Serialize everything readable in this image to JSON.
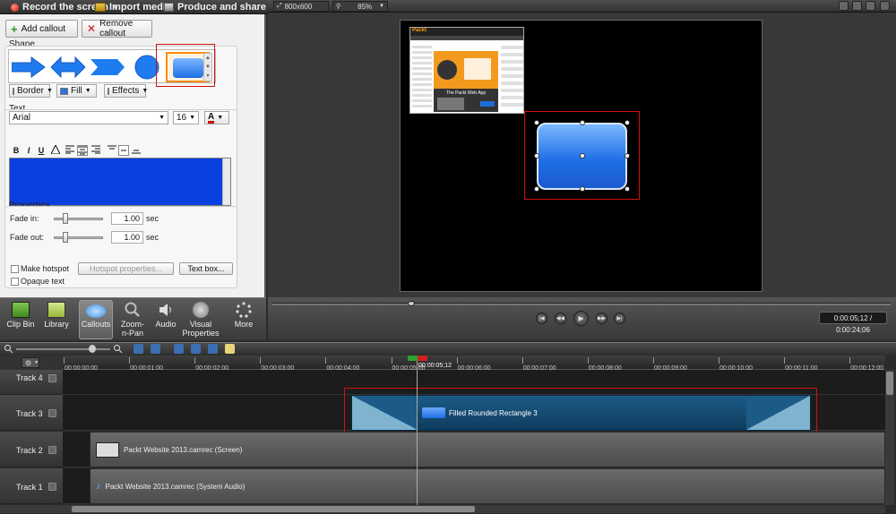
{
  "toolbar": {
    "record_label": "Record the screen",
    "import_label": "Import media",
    "produce_label": "Produce and share"
  },
  "callouts": {
    "add_label": "Add callout",
    "remove_label": "Remove callout",
    "shape_label": "Shape",
    "border_label": "Border",
    "fill_label": "Fill",
    "effects_label": "Effects",
    "text_label": "Text",
    "font_name": "Arial",
    "font_size": "16",
    "format_buttons": [
      "B",
      "I",
      "U"
    ],
    "properties_label": "Properties",
    "fade_in_label": "Fade in:",
    "fade_in_value": "1.00",
    "fade_out_label": "Fade out:",
    "fade_out_value": "1.00",
    "unit": "sec",
    "make_hotspot_label": "Make hotspot",
    "hotspot_properties_label": "Hotspot properties...",
    "text_box_label": "Text box...",
    "opaque_text_label": "Opaque text"
  },
  "tabs": [
    "Clip Bin",
    "Library",
    "Callouts",
    "Zoom-n-Pan",
    "Audio",
    "Visual Properties",
    "More"
  ],
  "preview": {
    "dimensions": "800x600",
    "zoom": "85%",
    "time": "0:00:05;12 / 0:00:24;06"
  },
  "timeline": {
    "ticks": [
      "00:00:00;00",
      "00:00:01;00",
      "00:00:02;00",
      "00:00:03;00",
      "00:00:04;00",
      "00:00:05;00",
      "00:00:05;12",
      "00:00:06;00",
      "00:00:07;00",
      "00:00:08;00",
      "00:00:09;00",
      "00:00:10;00",
      "00:00:11;00",
      "00:00:12;00"
    ],
    "tracks": [
      "Track 4",
      "Track 3",
      "Track 2",
      "Track 1"
    ],
    "callout_clip": "Filled Rounded Rectangle 3",
    "screen_clip": "Packt Website 2013.camrec (Screen)",
    "audio_clip": "Packt Website 2013.camrec (System Audio)"
  },
  "site_thumb": {
    "title": "Packt",
    "banner": "The Packt Web App"
  },
  "colors": {
    "accent_red": "#d01010",
    "callout_blue": "#2170e6",
    "selection_orange": "#ff8a00",
    "text_area_blue": "#0a3fe0"
  }
}
